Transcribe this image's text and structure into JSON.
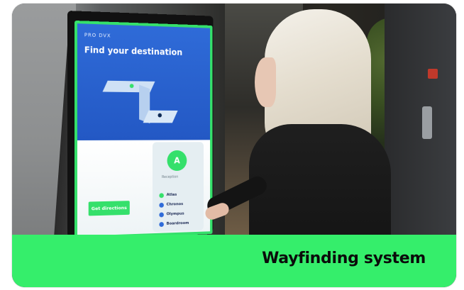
{
  "caption": "Wayfinding system",
  "colors": {
    "band_accent": "#35ee6b",
    "screen_blue": "#2f6bd8",
    "caption_text": "#0b0b0b"
  },
  "kiosk": {
    "brand": "PRO DVX",
    "title": "Find your destination",
    "marker": "A",
    "marker_sub": "Reception",
    "menu": [
      "Atlas",
      "Chronos",
      "Olympus",
      "Boardroom"
    ],
    "button": "Get directions"
  }
}
